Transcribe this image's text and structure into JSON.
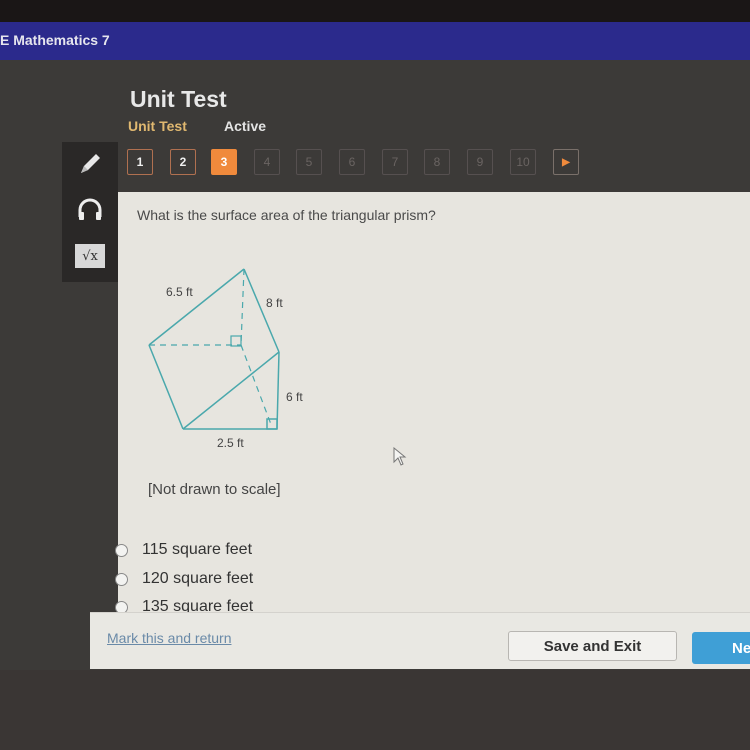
{
  "header": {
    "app_title": "E Mathematics 7"
  },
  "test": {
    "title": "Unit Test",
    "subtitle": "Unit Test",
    "status": "Active"
  },
  "tools": [
    {
      "name": "pencil-icon"
    },
    {
      "name": "headphones-icon"
    },
    {
      "name": "calculator-sqrt-icon",
      "glyph": "√x"
    }
  ],
  "navigation": {
    "questions": [
      {
        "label": "1",
        "state": "done"
      },
      {
        "label": "2",
        "state": "done"
      },
      {
        "label": "3",
        "state": "current"
      },
      {
        "label": "4",
        "state": "unvisited"
      },
      {
        "label": "5",
        "state": "unvisited"
      },
      {
        "label": "6",
        "state": "unvisited"
      },
      {
        "label": "7",
        "state": "unvisited"
      },
      {
        "label": "8",
        "state": "unvisited"
      },
      {
        "label": "9",
        "state": "unvisited"
      },
      {
        "label": "10",
        "state": "unvisited"
      }
    ],
    "next_arrow": "▶"
  },
  "question": {
    "text": "What is the surface area of the triangular prism?",
    "diagram_labels": {
      "hyp": "6.5 ft",
      "length": "8 ft",
      "height": "6 ft",
      "base": "2.5 ft"
    },
    "note": "[Not drawn to scale]",
    "options": [
      "115 square feet",
      "120 square feet",
      "135 square feet"
    ]
  },
  "footer": {
    "mark_link": "Mark this and return",
    "save_button": "Save and Exit",
    "next_button": "Ne"
  },
  "colors": {
    "topbar": "#2b2a8c",
    "current_question": "#f08a3c",
    "next_button": "#3f9fd6",
    "diagram_stroke": "#4aa8ac"
  }
}
